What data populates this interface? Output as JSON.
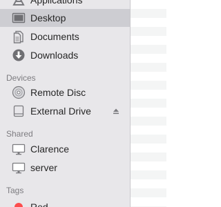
{
  "sidebar": {
    "favorites": [
      {
        "label": "Applications",
        "icon": "applications-icon"
      },
      {
        "label": "Desktop",
        "icon": "desktop-folder-icon",
        "selected": true
      },
      {
        "label": "Documents",
        "icon": "documents-icon"
      },
      {
        "label": "Downloads",
        "icon": "downloads-icon"
      }
    ],
    "devices_header": "Devices",
    "devices": [
      {
        "label": "Remote Disc",
        "icon": "remote-disc-icon"
      },
      {
        "label": "External Drive",
        "icon": "external-drive-icon",
        "eject_icon": "eject-icon"
      }
    ],
    "shared_header": "Shared",
    "shared": [
      {
        "label": "Clarence",
        "icon": "display-icon"
      },
      {
        "label": "server",
        "icon": "display-icon"
      }
    ],
    "tags_header": "Tags",
    "tags": [
      {
        "label": "Red",
        "icon": "tag-dot-icon",
        "color": "#fc4d4d"
      }
    ]
  },
  "colors": {
    "sidebar_background": "#e8e7ea",
    "selection": "#cdcdd2",
    "section_header": "#7d7c80",
    "icon_gray": "#7b7b7f"
  }
}
